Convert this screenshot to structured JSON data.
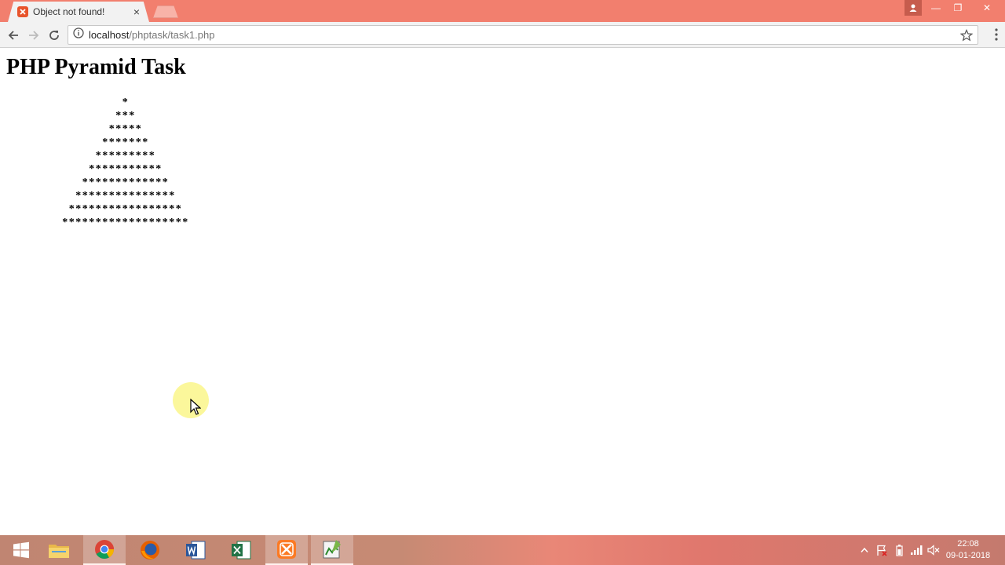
{
  "browser": {
    "tab": {
      "title": "Object not found!",
      "close_glyph": "×"
    },
    "address": {
      "host": "localhost",
      "path": "/phptask/task1.php"
    },
    "window_controls": {
      "minimize": "—",
      "restore": "❐",
      "close": "✕"
    }
  },
  "page": {
    "title": "PHP Pyramid Task",
    "pyramid_rows": [
      "*",
      "***",
      "*****",
      "*******",
      "*********",
      "***********",
      "*************",
      "***************",
      "*****************",
      "*******************"
    ]
  },
  "taskbar": {
    "apps": [
      {
        "name": "Windows Start",
        "icon": "windows-icon"
      },
      {
        "name": "File Explorer",
        "icon": "folder-icon"
      },
      {
        "name": "Google Chrome",
        "icon": "chrome-icon",
        "active": true
      },
      {
        "name": "Firefox",
        "icon": "firefox-icon"
      },
      {
        "name": "Word",
        "icon": "word-icon"
      },
      {
        "name": "Excel",
        "icon": "excel-icon"
      },
      {
        "name": "XAMPP",
        "icon": "xampp-icon"
      },
      {
        "name": "Editor",
        "icon": "editor-icon"
      }
    ],
    "clock": {
      "time": "22:08",
      "date": "09-01-2018"
    }
  },
  "colors": {
    "titlebar": "#f27f6e",
    "xampp_orange": "#e8542c"
  }
}
